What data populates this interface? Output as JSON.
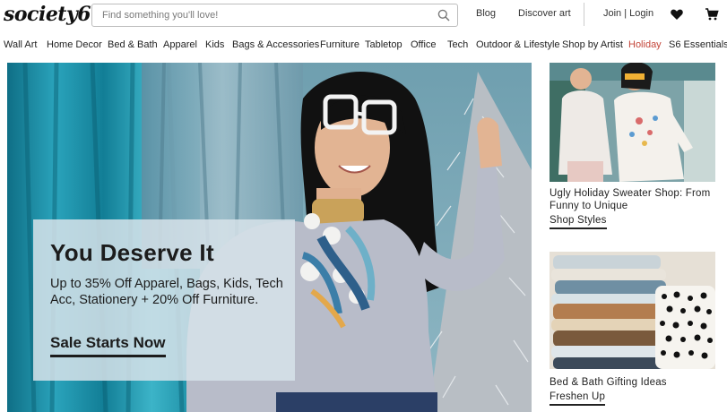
{
  "header": {
    "logo": "society6",
    "search_placeholder": "Find something you'll love!",
    "links": {
      "blog": "Blog",
      "discover": "Discover art",
      "login": "Join | Login"
    },
    "icons": {
      "search": "search-icon",
      "wishlist": "heart-icon",
      "cart": "cart-icon"
    }
  },
  "nav": {
    "items": [
      "Wall Art",
      "Home Decor",
      "Bed & Bath",
      "Apparel",
      "Kids",
      "Bags & Accessories",
      "Furniture",
      "Tabletop",
      "Office",
      "Tech",
      "Outdoor & Lifestyle",
      "Shop by Artist",
      "Holiday",
      "S6 Essentials"
    ]
  },
  "hero": {
    "title": "You Deserve It",
    "text": "Up to 35% Off Apparel, Bags, Kids, Tech Acc, Stationery + 20% Off Furniture.",
    "cta": "Sale Starts Now"
  },
  "cards": [
    {
      "title": "Ugly Holiday Sweater Shop: From Funny to Unique",
      "link": "Shop Styles"
    },
    {
      "title": "Bed & Bath Gifting Ideas",
      "link": "Freshen Up"
    }
  ],
  "colors": {
    "holiday": "#c4463a",
    "hero_bg": "#86b0bd",
    "promo_box": "#d6e2e9"
  }
}
